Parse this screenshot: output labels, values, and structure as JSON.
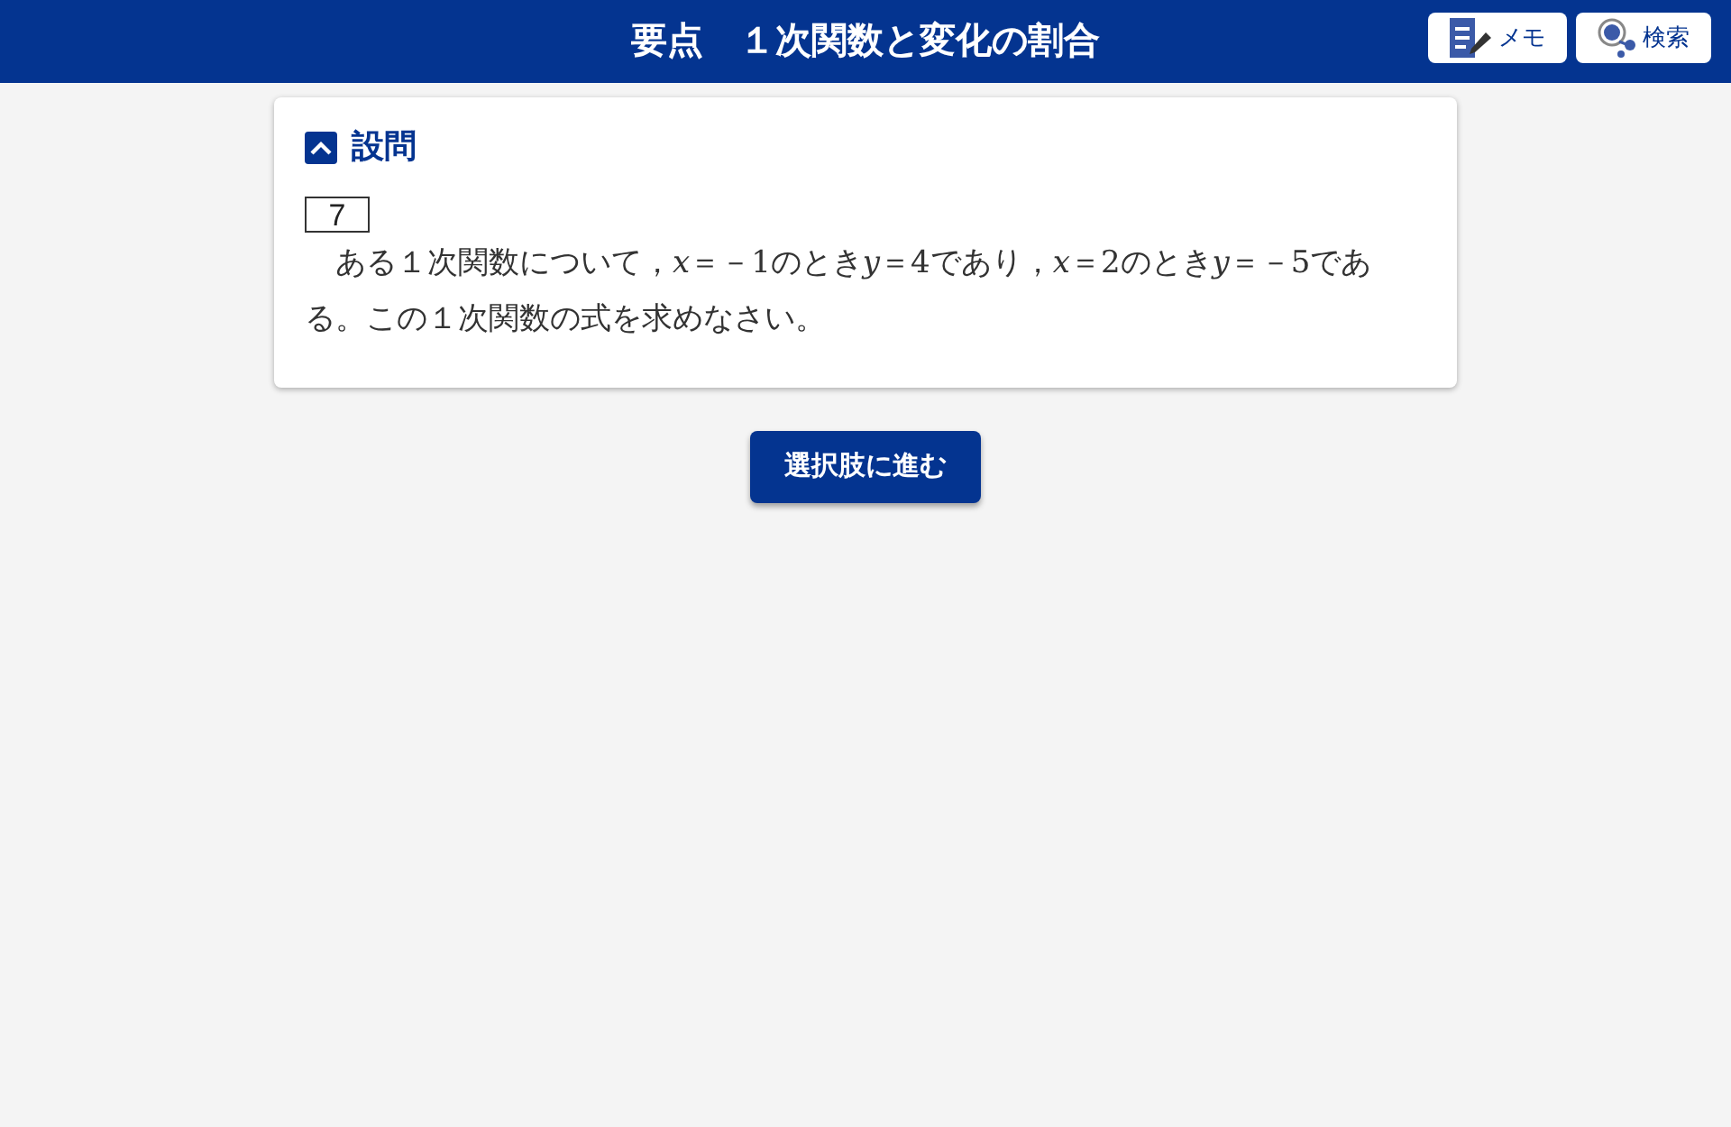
{
  "header": {
    "title": "要点　１次関数と変化の割合",
    "buttons": [
      {
        "kind": "memo",
        "label": "メモ"
      },
      {
        "kind": "search",
        "label": "検索"
      }
    ]
  },
  "section": {
    "title": "設問",
    "expanded": true,
    "number": "7",
    "text": [
      {
        "kind": "plain",
        "text": "　ある１次関数について，"
      },
      {
        "kind": "var",
        "text": "x"
      },
      {
        "kind": "plain",
        "text": "＝－1のとき"
      },
      {
        "kind": "var",
        "text": "y"
      },
      {
        "kind": "plain",
        "text": "＝4であり，"
      },
      {
        "kind": "var",
        "text": "x"
      },
      {
        "kind": "plain",
        "text": "＝2のとき"
      },
      {
        "kind": "var",
        "text": "y"
      },
      {
        "kind": "plain",
        "text": "＝－5である。この１次関数の式を求めなさい。"
      }
    ]
  },
  "action_button": "選択肢に進む"
}
